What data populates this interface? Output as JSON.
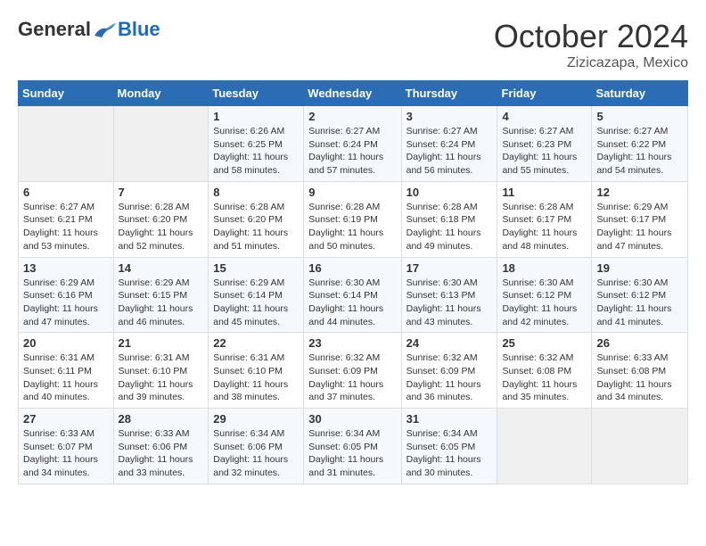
{
  "header": {
    "logo_general": "General",
    "logo_blue": "Blue",
    "month": "October 2024",
    "location": "Zizicazapa, Mexico"
  },
  "days_of_week": [
    "Sunday",
    "Monday",
    "Tuesday",
    "Wednesday",
    "Thursday",
    "Friday",
    "Saturday"
  ],
  "weeks": [
    [
      {
        "day": "",
        "empty": true
      },
      {
        "day": "",
        "empty": true
      },
      {
        "day": "1",
        "sunrise": "6:26 AM",
        "sunset": "6:25 PM",
        "daylight": "11 hours and 58 minutes."
      },
      {
        "day": "2",
        "sunrise": "6:27 AM",
        "sunset": "6:24 PM",
        "daylight": "11 hours and 57 minutes."
      },
      {
        "day": "3",
        "sunrise": "6:27 AM",
        "sunset": "6:24 PM",
        "daylight": "11 hours and 56 minutes."
      },
      {
        "day": "4",
        "sunrise": "6:27 AM",
        "sunset": "6:23 PM",
        "daylight": "11 hours and 55 minutes."
      },
      {
        "day": "5",
        "sunrise": "6:27 AM",
        "sunset": "6:22 PM",
        "daylight": "11 hours and 54 minutes."
      }
    ],
    [
      {
        "day": "6",
        "sunrise": "6:27 AM",
        "sunset": "6:21 PM",
        "daylight": "11 hours and 53 minutes."
      },
      {
        "day": "7",
        "sunrise": "6:28 AM",
        "sunset": "6:20 PM",
        "daylight": "11 hours and 52 minutes."
      },
      {
        "day": "8",
        "sunrise": "6:28 AM",
        "sunset": "6:20 PM",
        "daylight": "11 hours and 51 minutes."
      },
      {
        "day": "9",
        "sunrise": "6:28 AM",
        "sunset": "6:19 PM",
        "daylight": "11 hours and 50 minutes."
      },
      {
        "day": "10",
        "sunrise": "6:28 AM",
        "sunset": "6:18 PM",
        "daylight": "11 hours and 49 minutes."
      },
      {
        "day": "11",
        "sunrise": "6:28 AM",
        "sunset": "6:17 PM",
        "daylight": "11 hours and 48 minutes."
      },
      {
        "day": "12",
        "sunrise": "6:29 AM",
        "sunset": "6:17 PM",
        "daylight": "11 hours and 47 minutes."
      }
    ],
    [
      {
        "day": "13",
        "sunrise": "6:29 AM",
        "sunset": "6:16 PM",
        "daylight": "11 hours and 47 minutes."
      },
      {
        "day": "14",
        "sunrise": "6:29 AM",
        "sunset": "6:15 PM",
        "daylight": "11 hours and 46 minutes."
      },
      {
        "day": "15",
        "sunrise": "6:29 AM",
        "sunset": "6:14 PM",
        "daylight": "11 hours and 45 minutes."
      },
      {
        "day": "16",
        "sunrise": "6:30 AM",
        "sunset": "6:14 PM",
        "daylight": "11 hours and 44 minutes."
      },
      {
        "day": "17",
        "sunrise": "6:30 AM",
        "sunset": "6:13 PM",
        "daylight": "11 hours and 43 minutes."
      },
      {
        "day": "18",
        "sunrise": "6:30 AM",
        "sunset": "6:12 PM",
        "daylight": "11 hours and 42 minutes."
      },
      {
        "day": "19",
        "sunrise": "6:30 AM",
        "sunset": "6:12 PM",
        "daylight": "11 hours and 41 minutes."
      }
    ],
    [
      {
        "day": "20",
        "sunrise": "6:31 AM",
        "sunset": "6:11 PM",
        "daylight": "11 hours and 40 minutes."
      },
      {
        "day": "21",
        "sunrise": "6:31 AM",
        "sunset": "6:10 PM",
        "daylight": "11 hours and 39 minutes."
      },
      {
        "day": "22",
        "sunrise": "6:31 AM",
        "sunset": "6:10 PM",
        "daylight": "11 hours and 38 minutes."
      },
      {
        "day": "23",
        "sunrise": "6:32 AM",
        "sunset": "6:09 PM",
        "daylight": "11 hours and 37 minutes."
      },
      {
        "day": "24",
        "sunrise": "6:32 AM",
        "sunset": "6:09 PM",
        "daylight": "11 hours and 36 minutes."
      },
      {
        "day": "25",
        "sunrise": "6:32 AM",
        "sunset": "6:08 PM",
        "daylight": "11 hours and 35 minutes."
      },
      {
        "day": "26",
        "sunrise": "6:33 AM",
        "sunset": "6:08 PM",
        "daylight": "11 hours and 34 minutes."
      }
    ],
    [
      {
        "day": "27",
        "sunrise": "6:33 AM",
        "sunset": "6:07 PM",
        "daylight": "11 hours and 34 minutes."
      },
      {
        "day": "28",
        "sunrise": "6:33 AM",
        "sunset": "6:06 PM",
        "daylight": "11 hours and 33 minutes."
      },
      {
        "day": "29",
        "sunrise": "6:34 AM",
        "sunset": "6:06 PM",
        "daylight": "11 hours and 32 minutes."
      },
      {
        "day": "30",
        "sunrise": "6:34 AM",
        "sunset": "6:05 PM",
        "daylight": "11 hours and 31 minutes."
      },
      {
        "day": "31",
        "sunrise": "6:34 AM",
        "sunset": "6:05 PM",
        "daylight": "11 hours and 30 minutes."
      },
      {
        "day": "",
        "empty": true
      },
      {
        "day": "",
        "empty": true
      }
    ]
  ]
}
